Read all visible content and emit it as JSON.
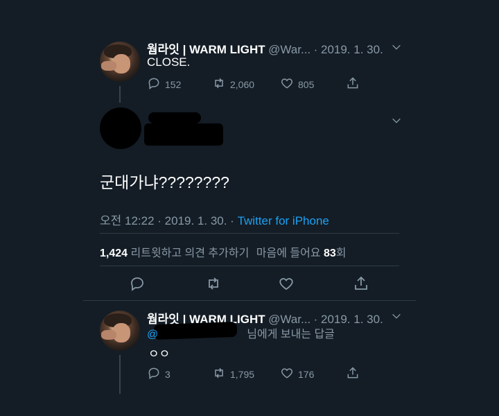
{
  "tweet1": {
    "name": "웜라잇 | WARM LIGHT",
    "handle": "@War...",
    "date": "· 2019. 1. 30.",
    "text": "CLOSE.",
    "replies": "152",
    "retweets": "2,060",
    "likes": "805"
  },
  "main_tweet": {
    "text": "군대가냐????????",
    "time": "오전 12:22 · 2019. 1. 30. ·",
    "source": "Twitter for iPhone",
    "retweet_count": "1,424",
    "retweet_label": "리트윗하고 의견 추가하기",
    "likes_label": "마음에 들어요",
    "likes_count": "83",
    "likes_suffix": "회"
  },
  "tweet2": {
    "name": "웜라잇 | WARM LIGHT",
    "handle": "@War...",
    "date": "· 2019. 1. 30.",
    "reply_to_suffix": "님에게 보내는 답글",
    "text": "ㅇㅇ",
    "replies": "3",
    "retweets": "1,795",
    "likes": "176"
  },
  "colors": {
    "background": "#141d26",
    "link": "#1da1f2",
    "muted": "#8899a6"
  },
  "icons": [
    "chevron-down-icon",
    "reply-icon",
    "retweet-icon",
    "like-icon",
    "share-icon"
  ]
}
